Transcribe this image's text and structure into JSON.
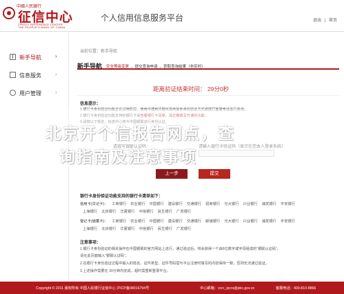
{
  "header": {
    "logo_top": "中國人民銀行",
    "logo_main": "征信中心",
    "logo_sub1": "CREDIT REFERENCE CENTER",
    "logo_sub2": "THE PEOPLE'S BANK OF CHINA",
    "site_title": "个人信用信息服务平台",
    "links": [
      "退出",
      "|",
      "首页"
    ]
  },
  "sidebar": {
    "items": [
      {
        "label": "新手导航",
        "icon": "book-icon",
        "active": true
      },
      {
        "label": "信息服务",
        "icon": "document-icon",
        "active": false
      },
      {
        "label": "用户管理",
        "icon": "user-icon",
        "active": false
      }
    ],
    "arrow": "›"
  },
  "main": {
    "breadcrumb": "当前位置：新手导航",
    "section_title": "新手导航",
    "steps": [
      "安全等级变更",
      " → 提交查询申请 → 获取查询结果（非实时）"
    ],
    "countdown": "距离验证结束时间：  29分0秒",
    "info_head": "信息提示：",
    "info_lines": [
      {
        "pre": "1.银行卡身份验证功能正在试用阶段，使用中遇到问题可改用其他身份验证方式或拨打客服电话进行咨询。",
        "hl": ""
      },
      {
        "pre": "2.银行卡身份验证功能支持的银行卡请",
        "hl": "查看银行卡清单，请正确填写开通的功能。"
      },
      {
        "pre": "3.请按以下规定，信息中心将与中国银联进行身份认证。",
        "hl": ""
      }
    ],
    "form": {
      "card_label": "请填写银联认证码：",
      "code_label": "请输入银行卡验证码（显示在您本人登录系统）"
    },
    "buttons": {
      "back": "上一步",
      "submit": "提交"
    },
    "banks_head": "银行卡身份验证功能支持的银行卡清单如下：",
    "bank_rows": [
      {
        "label": "信用卡(贷记卡)：",
        "banks": [
          "工商银行",
          "农业银行",
          "中国银行",
          "建设银行",
          "交通银行",
          "招商银行",
          "光大银行",
          "兴业银行",
          "浦发银行",
          "平安银行"
        ]
      },
      {
        "label": "",
        "banks": [
          "上海银行",
          "北京银行",
          "华夏银行",
          "中信银行",
          "民生银行",
          "广发银行"
        ]
      },
      {
        "label": "借记卡(储蓄卡)：",
        "banks": [
          "工商银行",
          "农业银行",
          "中国银行",
          "建设银行",
          "交通银行",
          "邮储银行",
          "光大银行",
          "兴业银行",
          "浦发银行",
          "平安银行"
        ]
      },
      {
        "label": "",
        "banks": [
          "上海银行",
          "北京银行",
          "华夏银行",
          "中信银行",
          "民生银行",
          "广发银行"
        ]
      }
    ],
    "notes_head": "注意事项：",
    "notes": [
      "1.银行卡身份验证的相关操作在中国银联的官方网站上进行，通过验证后，将会获得一个由6位数字或字母组成的“银联认证码”，",
      "请在此页面输入“银联认证码”。",
      "2.在银行卡身份验证过程中输入的姓名、证件类型、证件号码需与平台注册时填写的内容保持一致，否则无法通过验证。",
      "3.上述操作需要在 30分钟内完成，超时需重新登录平台。"
    ]
  },
  "overlay": {
    "line1": "北京开个信报告网点，查",
    "line2": "询指南及注意事项"
  },
  "footer": {
    "copyright": "Copyright © 2011  版权所有  中国人民银行征信中心  沪ICP备08016794号",
    "email": "中心邮箱：ccrc_ipcrs@pbc.gov.cn",
    "phone": "客服电话：400-810-8866"
  }
}
